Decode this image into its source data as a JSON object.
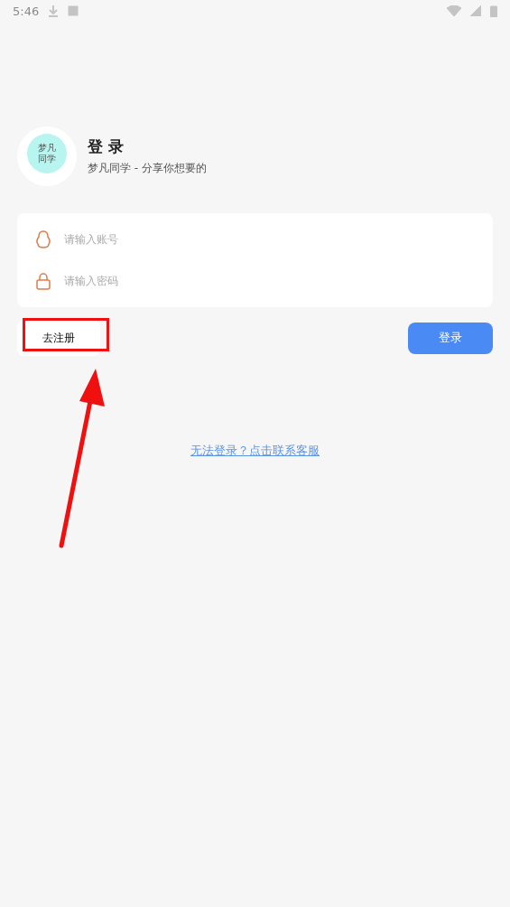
{
  "status_bar": {
    "time": "5:46"
  },
  "header": {
    "logo_lines": [
      "梦凡",
      "同学"
    ],
    "title": "登 录",
    "subtitle": "梦凡同学 - 分享你想要的"
  },
  "form": {
    "fields": [
      {
        "kind": "account",
        "placeholder": "请输入账号"
      },
      {
        "kind": "password",
        "placeholder": "请输入密码"
      }
    ]
  },
  "register_button": "去注册",
  "login_button": "登录",
  "help_link": "无法登录？点击联系客服"
}
